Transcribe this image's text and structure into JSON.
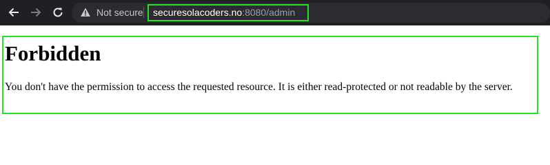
{
  "browser": {
    "security_label": "Not secure",
    "url_host": "securesolacoders.no",
    "url_rest": ":8080/admin",
    "highlight_color": "#23e523",
    "icons": [
      "back-arrow-icon",
      "forward-arrow-icon",
      "reload-icon",
      "warning-icon"
    ]
  },
  "page": {
    "heading": "Forbidden",
    "message": "You don't have the permission to access the requested resource. It is either read-protected or not readable by the server."
  }
}
